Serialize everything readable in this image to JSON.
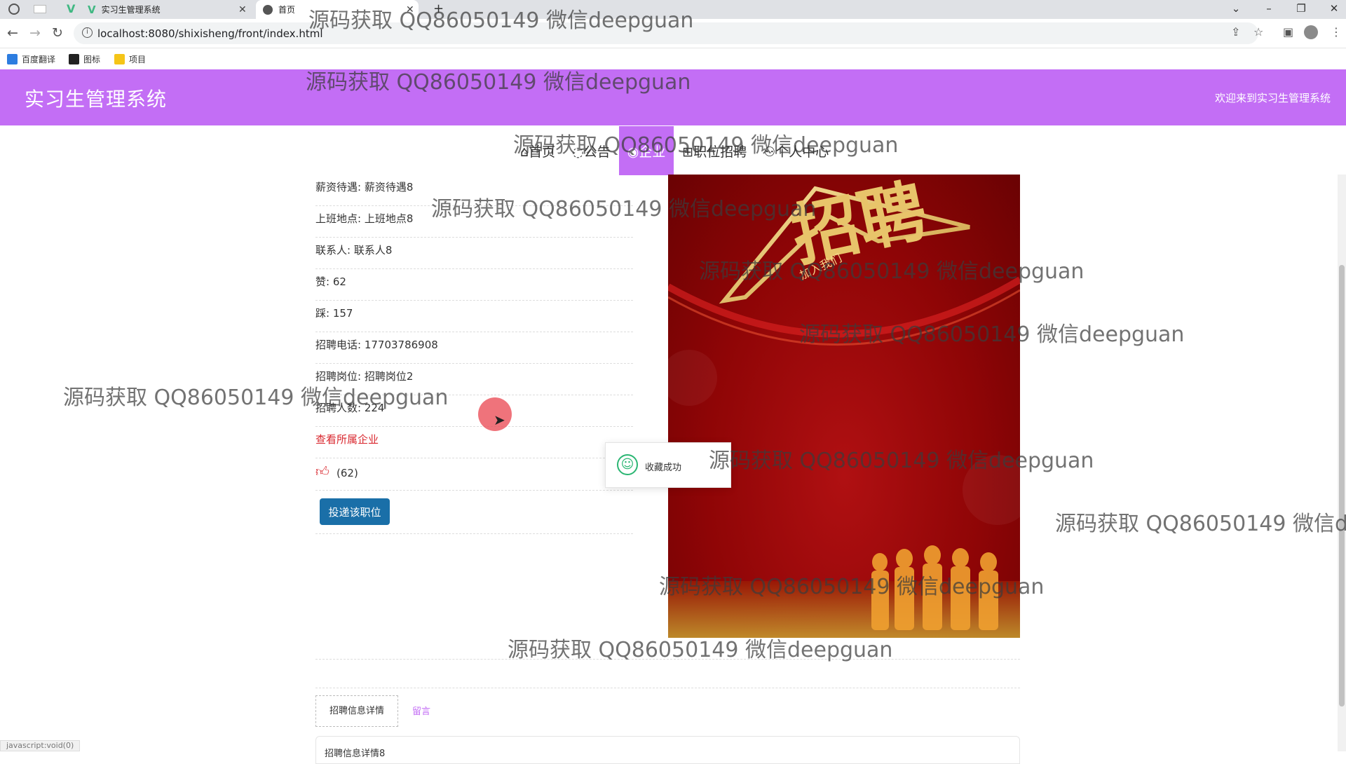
{
  "browser": {
    "tabs": [
      {
        "label": "实习生管理系统",
        "icon": "vue-icon"
      },
      {
        "label": "首页",
        "icon": "globe-icon"
      }
    ],
    "new_tab_icon": "plus-icon",
    "address": "localhost:8080/shixisheng/front/index.html",
    "bookmarks": [
      {
        "label": "百度翻译",
        "icon": "translate-icon"
      },
      {
        "label": "图标",
        "icon": "image-icon"
      },
      {
        "label": "项目",
        "icon": "folder-icon"
      }
    ],
    "status_text": "javascript:void(0)"
  },
  "header": {
    "title": "实习生管理系统",
    "welcome": "欢迎来到实习生管理系统",
    "color": "#c36ef5"
  },
  "nav": {
    "items": [
      {
        "label": "首页",
        "icon": "home-icon"
      },
      {
        "label": "公告",
        "icon": "bell-icon"
      },
      {
        "label": "企业",
        "icon": "eye-icon",
        "active": true
      },
      {
        "label": "职位招聘",
        "icon": "grid-icon"
      },
      {
        "label": "个人中心",
        "icon": "user-icon"
      }
    ]
  },
  "job": {
    "salary": "薪资待遇: 薪资待遇8",
    "location": "上班地点: 上班地点8",
    "contact": "联系人: 联系人8",
    "likes": "赞: 62",
    "dislikes": "踩: 157",
    "phone": "招聘电话: 17703786908",
    "position": "招聘岗位: 招聘岗位2",
    "headcount": "招聘人数: 224",
    "view_company": "查看所属企业",
    "like_count": "(62)",
    "apply_button": "投递该职位"
  },
  "poster": {
    "headline": "招聘",
    "subline": "加入我们",
    "alt": "recruitment-poster"
  },
  "toast": {
    "message": "收藏成功",
    "icon": "smile-icon"
  },
  "tabs_bottom": {
    "detail_tab": "招聘信息详情",
    "comment_tab": "留言",
    "content": "招聘信息详情8"
  },
  "watermark": "源码获取 QQ86050149 微信deepguan"
}
